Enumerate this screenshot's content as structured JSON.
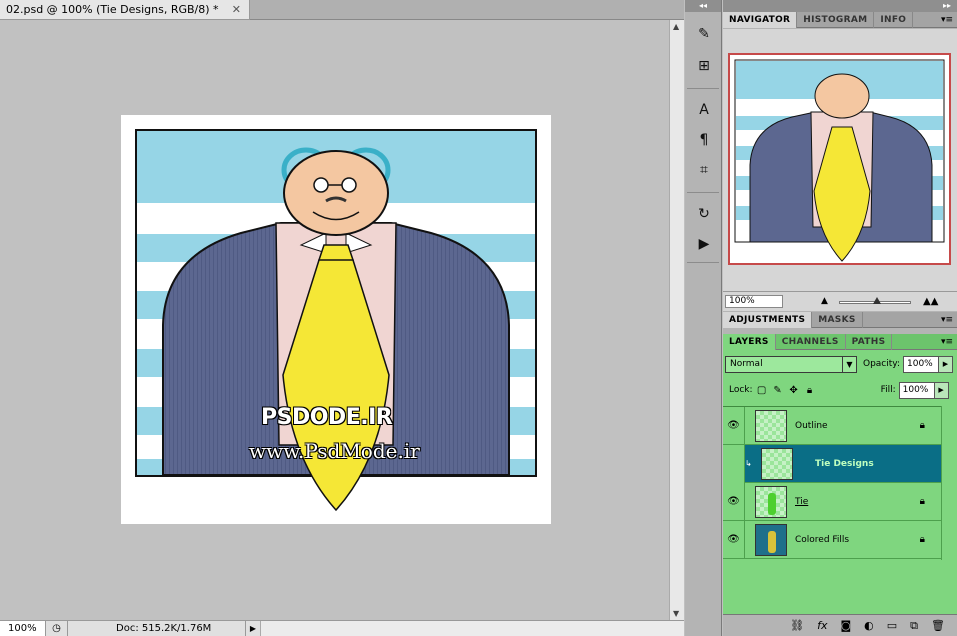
{
  "document": {
    "tab_title": "02.psd @ 100% (Tie Designs, RGB/8) *",
    "watermark_top": "PSDODE.IR",
    "watermark_bottom": "www.PsdMode.ir"
  },
  "status": {
    "zoom": "100%",
    "doc_info": "Doc: 515.2K/1.76M"
  },
  "panels": {
    "nav_tabs": [
      "NAVIGATOR",
      "HISTOGRAM",
      "INFO"
    ],
    "nav_zoom": "100%",
    "adj_tabs": [
      "ADJUSTMENTS",
      "MASKS"
    ],
    "layer_tabs": [
      "LAYERS",
      "CHANNELS",
      "PATHS"
    ]
  },
  "layers_panel": {
    "blend_mode": "Normal",
    "opacity_label": "Opacity:",
    "opacity": "100%",
    "lock_label": "Lock:",
    "fill_label": "Fill:",
    "fill": "100%",
    "layers": [
      {
        "name": "Outline",
        "selected": false,
        "locked": true
      },
      {
        "name": "Tie Designs",
        "selected": true,
        "locked": false
      },
      {
        "name": "Tie",
        "selected": false,
        "locked": true
      },
      {
        "name": "Colored Fills",
        "selected": false,
        "locked": true
      }
    ]
  },
  "colors": {
    "accent_selection": "#0a6e86",
    "layers_bg": "#7fd67f",
    "nav_frame": "#c64a4a"
  }
}
